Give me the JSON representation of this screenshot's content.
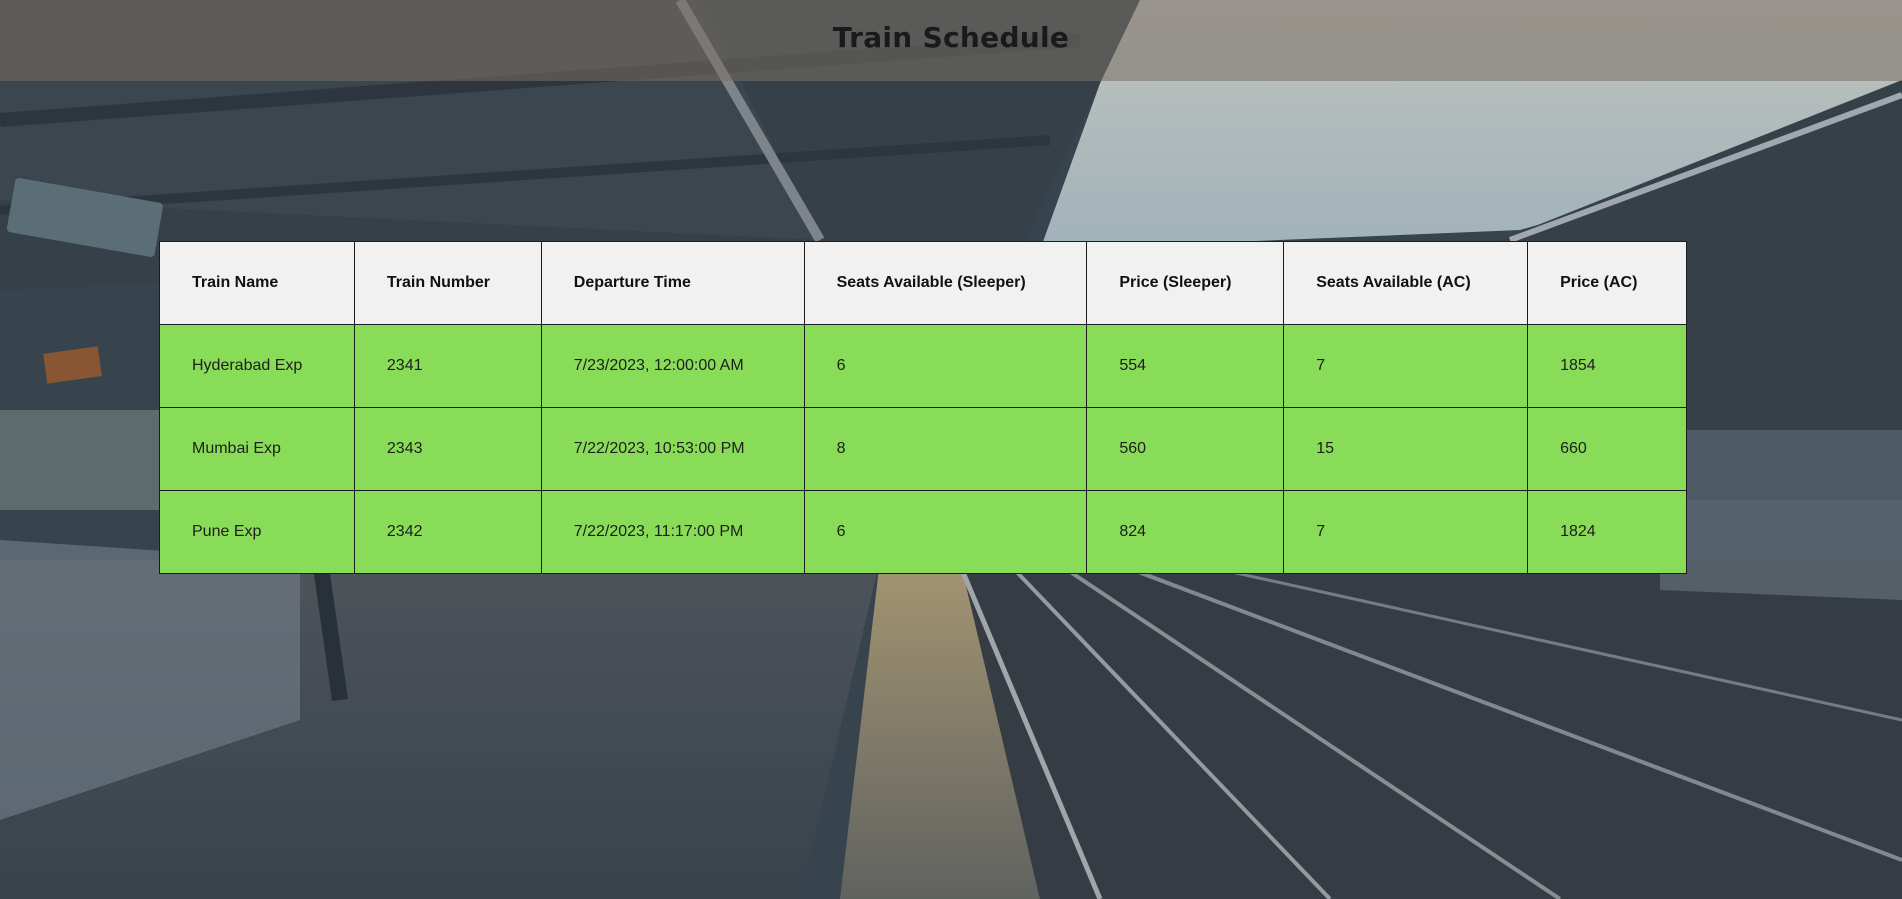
{
  "page": {
    "title": "Train Schedule"
  },
  "colors": {
    "header_bg": "#786f64",
    "row_bg": "#89dc57",
    "header_row_bg": "#f1f1f2",
    "border": "#1c1c1c"
  },
  "table": {
    "columns": [
      "Train Name",
      "Train Number",
      "Departure Time",
      "Seats Available (Sleeper)",
      "Price (Sleeper)",
      "Seats Available (AC)",
      "Price (AC)"
    ],
    "rows": [
      [
        "Hyderabad Exp",
        "2341",
        "7/23/2023, 12:00:00 AM",
        "6",
        "554",
        "7",
        "1854"
      ],
      [
        "Mumbai Exp",
        "2343",
        "7/22/2023, 10:53:00 PM",
        "8",
        "560",
        "15",
        "660"
      ],
      [
        "Pune Exp",
        "2342",
        "7/22/2023, 11:17:00 PM",
        "6",
        "824",
        "7",
        "1824"
      ]
    ]
  },
  "background": {
    "image": "train-platform-photo"
  }
}
